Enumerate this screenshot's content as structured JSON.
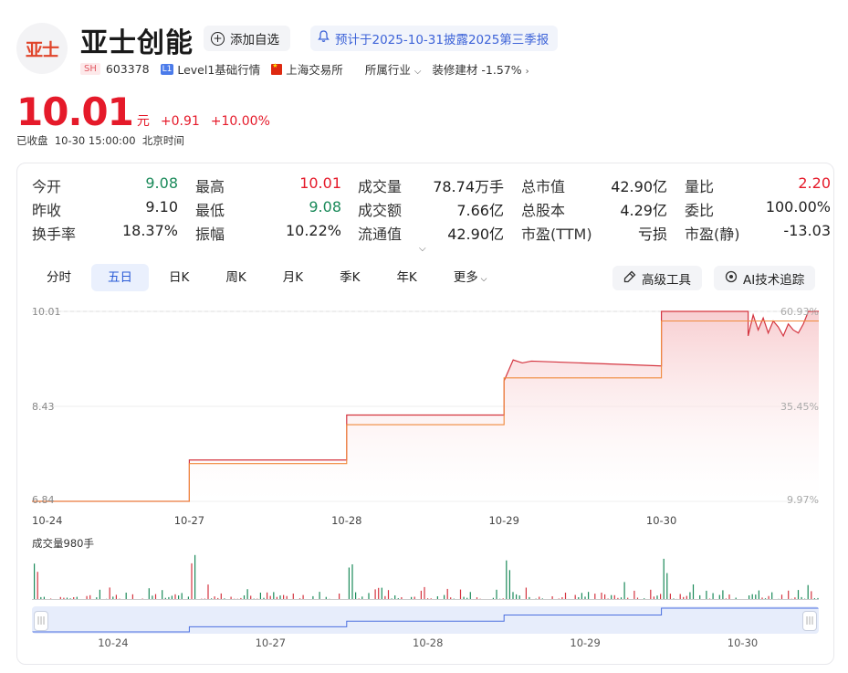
{
  "header": {
    "logo_text": "亚士",
    "name": "亚士创能",
    "add_watch_label": "添加自选",
    "notice_label": "预计于2025-10-31披露2025第三季报",
    "market_tag": "SH",
    "code": "603378",
    "level_tag": "L1",
    "level_label": "Level1基础行情",
    "exchange": "上海交易所",
    "industry_label": "所属行业",
    "industry_value": "装修建材 -1.57%"
  },
  "price": {
    "value": "10.01",
    "unit": "元",
    "change": "+0.91",
    "change_pct": "+10.00%",
    "status": "已收盘",
    "time": "10-30 15:00:00",
    "tz": "北京时间"
  },
  "quote": [
    [
      {
        "label": "今开",
        "value": "9.08",
        "color": "green"
      },
      {
        "label": "昨收",
        "value": "9.10",
        "color": ""
      },
      {
        "label": "换手率",
        "value": "18.37%",
        "color": ""
      }
    ],
    [
      {
        "label": "最高",
        "value": "10.01",
        "color": "red"
      },
      {
        "label": "最低",
        "value": "9.08",
        "color": "green"
      },
      {
        "label": "振幅",
        "value": "10.22%",
        "color": ""
      }
    ],
    [
      {
        "label": "成交量",
        "value": "78.74万手",
        "color": ""
      },
      {
        "label": "成交额",
        "value": "7.66亿",
        "color": ""
      },
      {
        "label": "流通值",
        "value": "42.90亿",
        "color": ""
      }
    ],
    [
      {
        "label": "总市值",
        "value": "42.90亿",
        "color": ""
      },
      {
        "label": "总股本",
        "value": "4.29亿",
        "color": ""
      },
      {
        "label": "市盈(TTM)",
        "value": "亏损",
        "color": ""
      }
    ],
    [
      {
        "label": "量比",
        "value": "2.20",
        "color": "red"
      },
      {
        "label": "委比",
        "value": "100.00%",
        "color": ""
      },
      {
        "label": "市盈(静)",
        "value": "-13.03",
        "color": ""
      }
    ]
  ],
  "tabs": [
    "分时",
    "五日",
    "日K",
    "周K",
    "月K",
    "季K",
    "年K",
    "更多"
  ],
  "active_tab": "五日",
  "tools": {
    "advanced": "高级工具",
    "ai": "AI技术追踪"
  },
  "chart_data": {
    "type": "line",
    "x_labels": [
      "10-24",
      "10-27",
      "10-28",
      "10-29",
      "10-30"
    ],
    "y_labels": [
      "10.01",
      "8.43",
      "6.84"
    ],
    "pct_labels": [
      "60.93%",
      "35.45%",
      "9.97%"
    ],
    "ylim": [
      6.84,
      10.01
    ],
    "price_steps": [
      6.84,
      7.53,
      8.28,
      9.1,
      10.01
    ],
    "avg_steps": [
      6.84,
      7.47,
      8.12,
      8.9,
      9.85
    ],
    "volume_title": "成交量980手",
    "series": [
      {
        "values": [
          6.84,
          7.53,
          8.28,
          9.1,
          10.01
        ]
      },
      {
        "values": [
          6.84,
          7.47,
          8.12,
          8.9,
          9.85
        ]
      }
    ],
    "colors": {
      "price": "#d4343f",
      "avg": "#f08a3c",
      "fill": "#fbe3e4"
    }
  },
  "navigator_labels": [
    "10-24",
    "10-27",
    "10-28",
    "10-29",
    "10-30"
  ]
}
